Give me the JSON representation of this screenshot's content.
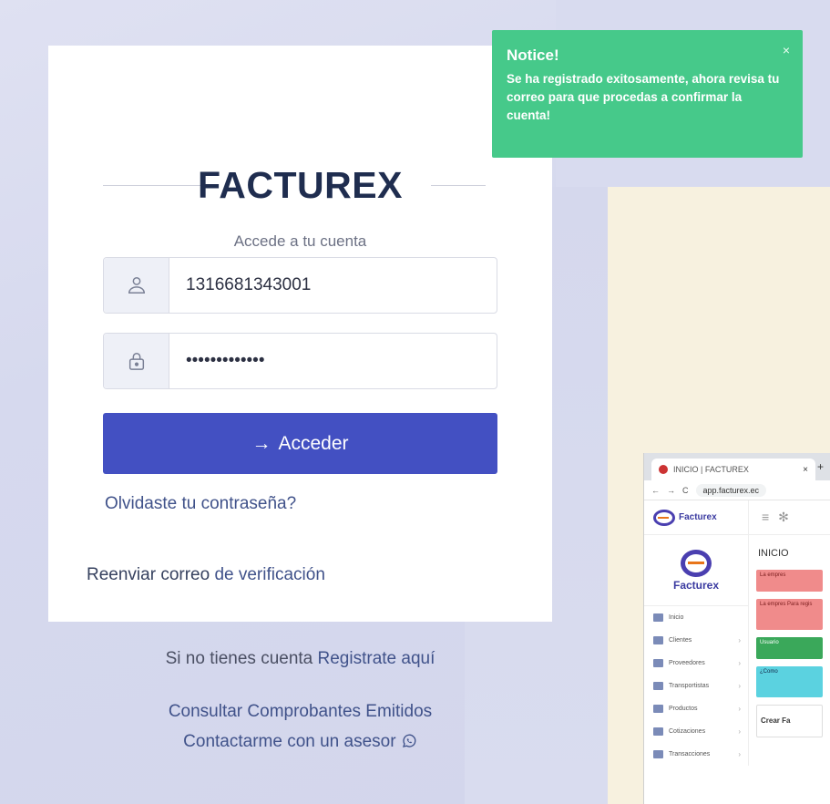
{
  "brand": "FACTUREX",
  "subtitle": "Accede a tu cuenta",
  "login": {
    "username_value": "1316681343001",
    "password_value": "•••••••••••••",
    "submit_label": "Acceder",
    "forgot_label": "Olvidaste tu contraseña?",
    "resend_prefix": "Reenviar correo ",
    "resend_link": "de verificación"
  },
  "signup": {
    "prefix": "Si no tienes cuenta ",
    "link": "Registrate aquí"
  },
  "consult_label": "Consultar Comprobantes Emitidos",
  "contact_label": "Contactarme con un asesor",
  "notice": {
    "title": "Notice!",
    "message": "Se ha registrado exitosamente, ahora revisa tu correo para que procedas a confirmar la cuenta!",
    "close": "×"
  },
  "thumbnail": {
    "tab_title": "INICIO | FACTUREX",
    "url": "app.facturex.ec",
    "logo_small": "Facturex",
    "logo_big": "Facturex",
    "page_title": "INICIO",
    "nav": [
      "Inicio",
      "Clientes",
      "Proveedores",
      "Transportistas",
      "Productos",
      "Cotizaciones",
      "Transacciones"
    ],
    "alerts": [
      "La empres",
      "La empres Para regis",
      "Usuario",
      "¿Como"
    ],
    "crear": "Crear Fa"
  },
  "colors": {
    "primary": "#4350c2",
    "notice": "#46c98a",
    "link": "#40528a"
  }
}
